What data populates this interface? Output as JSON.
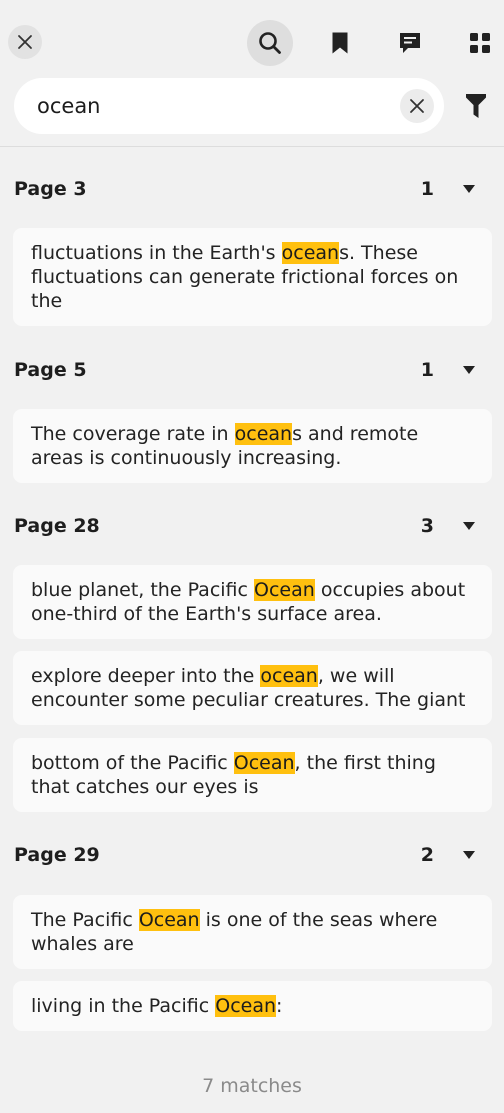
{
  "toolbar": {
    "icons": [
      "close-icon",
      "search-icon",
      "bookmark-icon",
      "comment-icon",
      "grid-icon"
    ]
  },
  "search": {
    "value": "ocean",
    "icons": [
      "clear-icon",
      "filter-icon"
    ]
  },
  "groups": [
    {
      "label": "Page 3",
      "count": "1",
      "results": [
        {
          "before": "fluctuations in the Earth's ",
          "match": "ocean",
          "after": "s. These fluctuations can generate frictional forces on the"
        }
      ]
    },
    {
      "label": "Page 5",
      "count": "1",
      "results": [
        {
          "before": "The coverage rate in ",
          "match": "ocean",
          "after": "s and remote areas is continuously increasing."
        }
      ]
    },
    {
      "label": "Page 28",
      "count": "3",
      "results": [
        {
          "before": "blue planet, the Pacific ",
          "match": "Ocean",
          "after": " occupies about one-third of the Earth's surface area."
        },
        {
          "before": "explore deeper into the ",
          "match": "ocean",
          "after": ", we will encounter some peculiar creatures. The giant"
        },
        {
          "before": "bottom of the Pacific ",
          "match": "Ocean",
          "after": ", the first thing that catches our eyes is"
        }
      ]
    },
    {
      "label": "Page 29",
      "count": "2",
      "results": [
        {
          "before": "The Pacific ",
          "match": "Ocean",
          "after": " is one of the seas where whales are"
        },
        {
          "before": "living in the Pacific ",
          "match": "Ocean",
          "after": ":"
        }
      ]
    }
  ],
  "footer": {
    "matches": "7 matches"
  },
  "colors": {
    "highlight": "#ffc00f",
    "background": "#f1f1f1",
    "card": "#fafafa"
  }
}
